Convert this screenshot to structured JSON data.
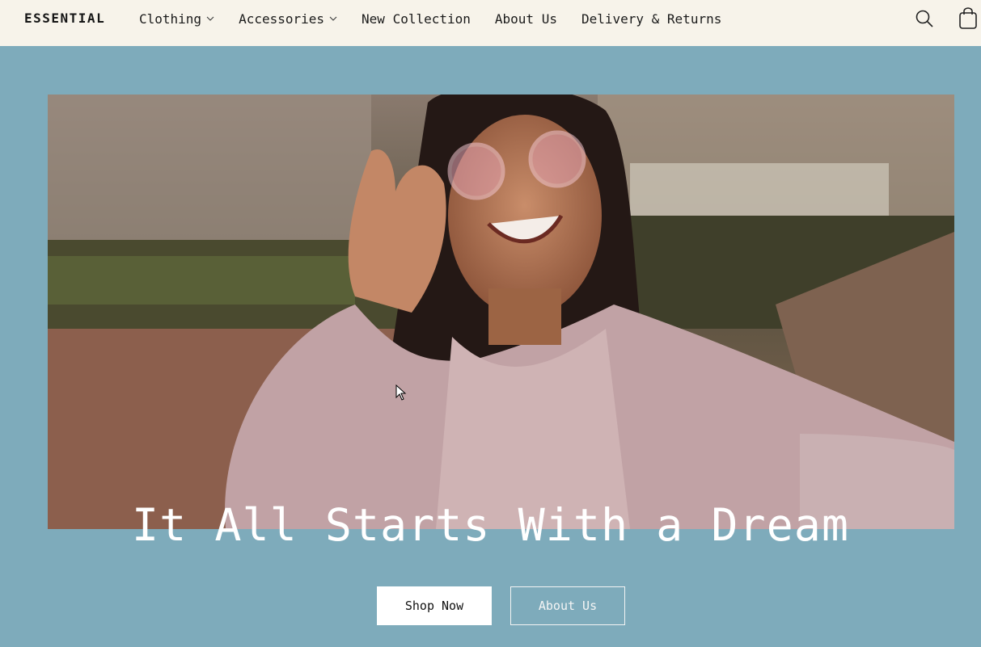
{
  "header": {
    "brand": "ESSENTIAL",
    "nav": [
      {
        "label": "Clothing",
        "has_dropdown": true
      },
      {
        "label": "Accessories",
        "has_dropdown": true
      },
      {
        "label": "New Collection",
        "has_dropdown": false
      },
      {
        "label": "About Us",
        "has_dropdown": false
      },
      {
        "label": "Delivery & Returns",
        "has_dropdown": false
      }
    ],
    "icons": [
      "search-icon",
      "shopping-bag-icon"
    ]
  },
  "hero": {
    "title": "It All Starts With a Dream",
    "primary_button": "Shop Now",
    "secondary_button": "About Us"
  },
  "colors": {
    "background": "#7eabbb",
    "header_bg": "#f7f3ea"
  }
}
